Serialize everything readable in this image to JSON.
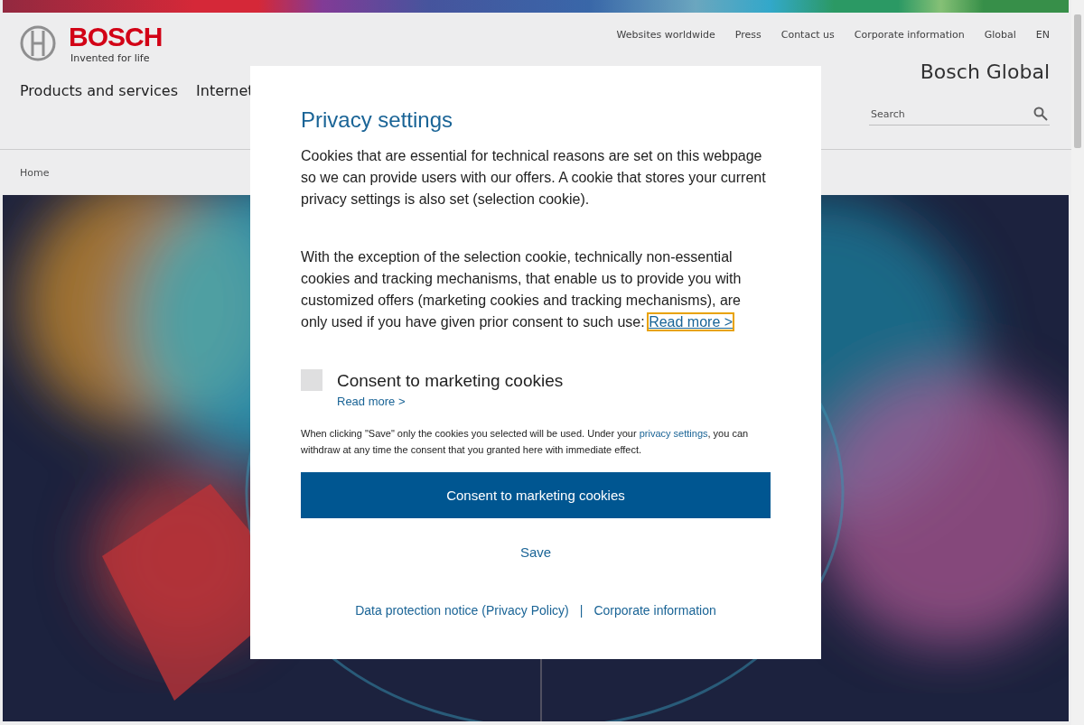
{
  "header": {
    "logo": "BOSCH",
    "tagline": "Invented for life",
    "top_links": [
      "Websites worldwide",
      "Press",
      "Contact us",
      "Corporate information",
      "Global"
    ],
    "language": "EN",
    "site_title": "Bosch Global",
    "nav": [
      "Products and services",
      "Internet"
    ],
    "search": {
      "placeholder": "Search"
    },
    "breadcrumb": "Home"
  },
  "dialog": {
    "title": "Privacy settings",
    "paragraphs": [
      "Cookies that are essential for technical reasons are set on this webpage so we can provide users with our offers. A cookie that stores your current privacy settings is also set (selection cookie).",
      "With the exception of the selection cookie, technically non-essential cookies and tracking mechanisms, that enable us to provide you with customized offers (marketing cookies and tracking mechanisms), are only used if you have given prior consent to such use:"
    ],
    "paragraph_link": "Read more >",
    "option": {
      "label": "Consent to marketing cookies",
      "checked": false,
      "link": "Read more >"
    },
    "note": "When clicking \"Save\" only the cookies you selected will be used. Under your",
    "note_link": "privacy settings",
    "note_end": ", you can withdraw at any time the consent that you granted here with immediate effect.",
    "primary_button": "Consent to marketing cookies",
    "secondary_button": "Save",
    "footer_links": [
      "Data protection notice (Privacy Policy)",
      "Corporate information"
    ],
    "footer_separator": "|"
  }
}
